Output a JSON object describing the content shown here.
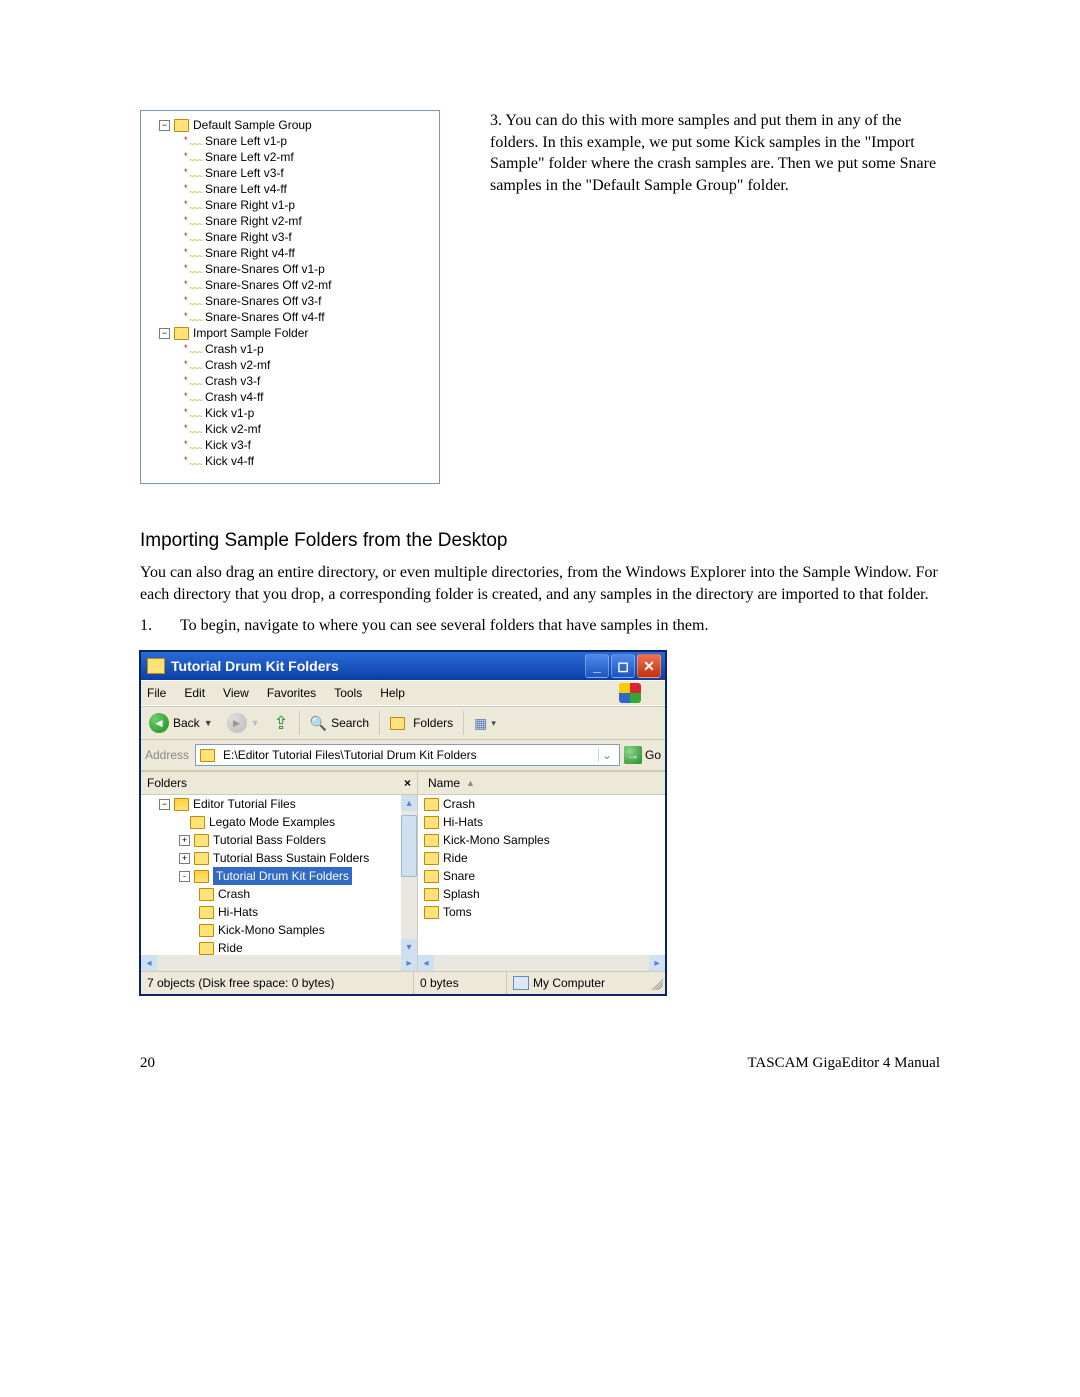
{
  "step3_text": "3. You can do this with more samples and put them in any of the folders.  In this example, we put some Kick samples in the \"Import Sample\" folder where the crash samples are. Then we put some Snare samples in the \"Default Sample Group\" folder.",
  "tree": {
    "groupA": "Default Sample Group",
    "groupB": "Import Sample Folder",
    "samplesA": [
      "Snare Left v1-p",
      "Snare Left v2-mf",
      "Snare Left v3-f",
      "Snare Left v4-ff",
      "Snare Right v1-p",
      "Snare Right v2-mf",
      "Snare Right v3-f",
      "Snare Right v4-ff",
      "Snare-Snares Off v1-p",
      "Snare-Snares Off v2-mf",
      "Snare-Snares Off v3-f",
      "Snare-Snares Off v4-ff"
    ],
    "samplesB": [
      "Crash v1-p",
      "Crash v2-mf",
      "Crash v3-f",
      "Crash v4-ff",
      "Kick v1-p",
      "Kick v2-mf",
      "Kick v3-f",
      "Kick v4-ff"
    ]
  },
  "section_heading": "Importing Sample Folders from the Desktop",
  "section_body": "You can also drag an entire directory, or even multiple directories, from the Windows Explorer into the Sample Window.  For each directory that you drop, a corresponding folder is created, and any samples in the directory are imported to that folder.",
  "step1_num": "1.",
  "step1_text": "To begin, navigate to where you can see several folders that have samples in them.",
  "explorer": {
    "title": "Tutorial Drum Kit Folders",
    "menu": [
      "File",
      "Edit",
      "View",
      "Favorites",
      "Tools",
      "Help"
    ],
    "toolbar": {
      "back": "Back",
      "search": "Search",
      "folders": "Folders"
    },
    "address_label": "Address",
    "address_path": "E:\\Editor Tutorial Files\\Tutorial Drum Kit Folders",
    "go": "Go",
    "folders_header": "Folders",
    "name_header": "Name",
    "left_tree": {
      "root": "Editor Tutorial Files",
      "children": [
        {
          "expand": "",
          "label": "Legato Mode Examples"
        },
        {
          "expand": "+",
          "label": "Tutorial Bass Folders"
        },
        {
          "expand": "+",
          "label": "Tutorial Bass Sustain Folders"
        },
        {
          "expand": "-",
          "label": "Tutorial Drum Kit Folders",
          "selected": true
        }
      ],
      "grandchildren": [
        "Crash",
        "Hi-Hats",
        "Kick-Mono Samples",
        "Ride"
      ]
    },
    "right_list": [
      "Crash",
      "Hi-Hats",
      "Kick-Mono Samples",
      "Ride",
      "Snare",
      "Splash",
      "Toms"
    ],
    "status_left": "7 objects (Disk free space: 0 bytes)",
    "status_mid": "0 bytes",
    "status_right": "My Computer"
  },
  "footer_left": "20",
  "footer_right": "TASCAM GigaEditor 4 Manual"
}
